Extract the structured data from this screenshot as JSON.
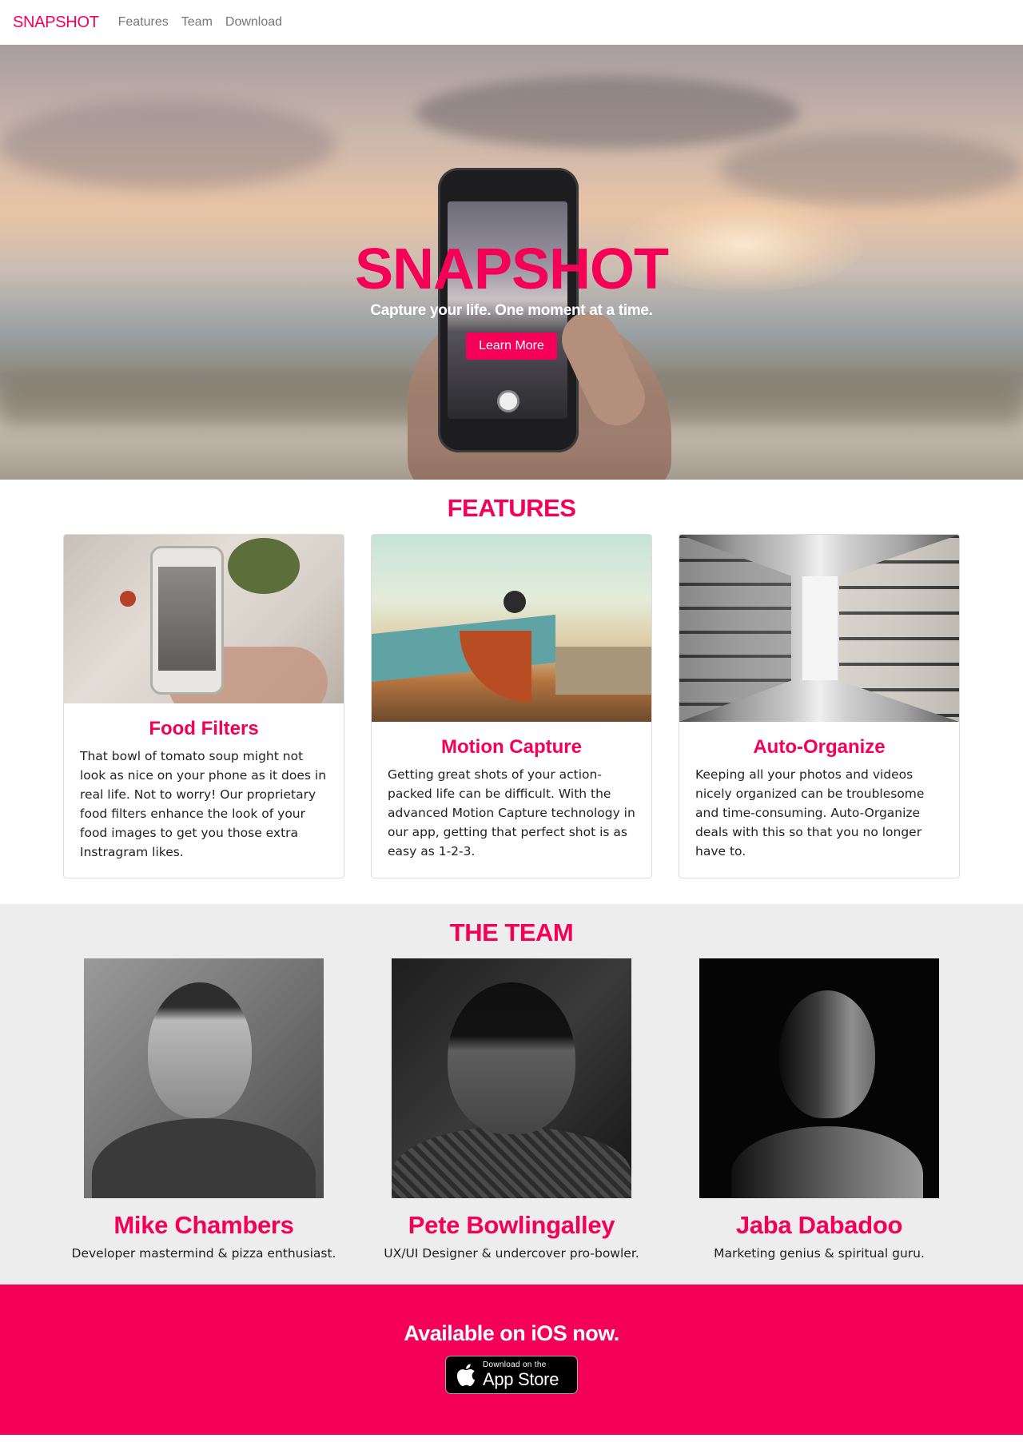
{
  "nav": {
    "brand": "SNAPSHOT",
    "links": [
      "Features",
      "Team",
      "Download"
    ]
  },
  "hero": {
    "title": "SNAPSHOT",
    "tagline": "Capture your life. One moment at a time.",
    "button": "Learn More"
  },
  "features": {
    "heading": "FEATURES",
    "cards": [
      {
        "title": "Food Filters",
        "text": "That bowl of tomato soup might not look as nice on your phone as it does in real life. Not to worry! Our proprietary food filters enhance the look of your food images to get you those extra Instragram likes."
      },
      {
        "title": "Motion Capture",
        "text": "Getting great shots of your action-packed life can be difficult. With the advanced Motion Capture technology in our app, getting that perfect shot is as easy as 1-2-3."
      },
      {
        "title": "Auto-Organize",
        "text": "Keeping all your photos and videos nicely organized can be troublesome and time-consuming. Auto-Organize deals with this so that you no longer have to."
      }
    ]
  },
  "team": {
    "heading": "THE TEAM",
    "members": [
      {
        "name": "Mike Chambers",
        "role": "Developer mastermind & pizza enthusiast."
      },
      {
        "name": "Pete Bowlingalley",
        "role": "UX/UI Designer & undercover pro-bowler."
      },
      {
        "name": "Jaba Dabadoo",
        "role": "Marketing genius & spiritual guru."
      }
    ]
  },
  "download": {
    "heading": "Available on iOS now.",
    "badge_small": "Download on the",
    "badge_big": "App Store"
  },
  "colors": {
    "accent": "#f50057",
    "team_bg": "#ededed"
  }
}
